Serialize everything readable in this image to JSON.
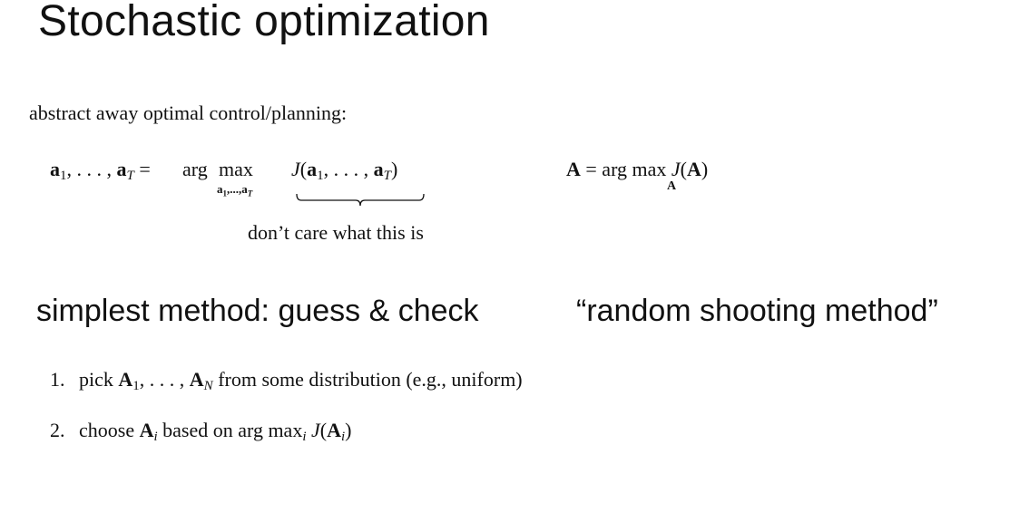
{
  "slide": {
    "title": "Stochastic optimization",
    "intro": "abstract away optimal control/planning:",
    "equation_left": {
      "lhs": "a₁, . . . , aₜ =",
      "arg": "arg",
      "max": "max",
      "subscript": "a₁,...,aₜ",
      "objective": "J(a₁, . . . , aₜ)",
      "brace_note": "don’t care what this is"
    },
    "equation_right": {
      "main": "A = arg max J(A)",
      "subscript": "A"
    },
    "heading_left": "simplest method: guess & check",
    "heading_right": "“random shooting method”",
    "steps": [
      {
        "number": "1.",
        "text": "pick A₁, . . . , Aₙ from some distribution (e.g., uniform)"
      },
      {
        "number": "2.",
        "text": "choose Aᵢ based on arg maxᵢ J(Aᵢ)"
      }
    ]
  }
}
